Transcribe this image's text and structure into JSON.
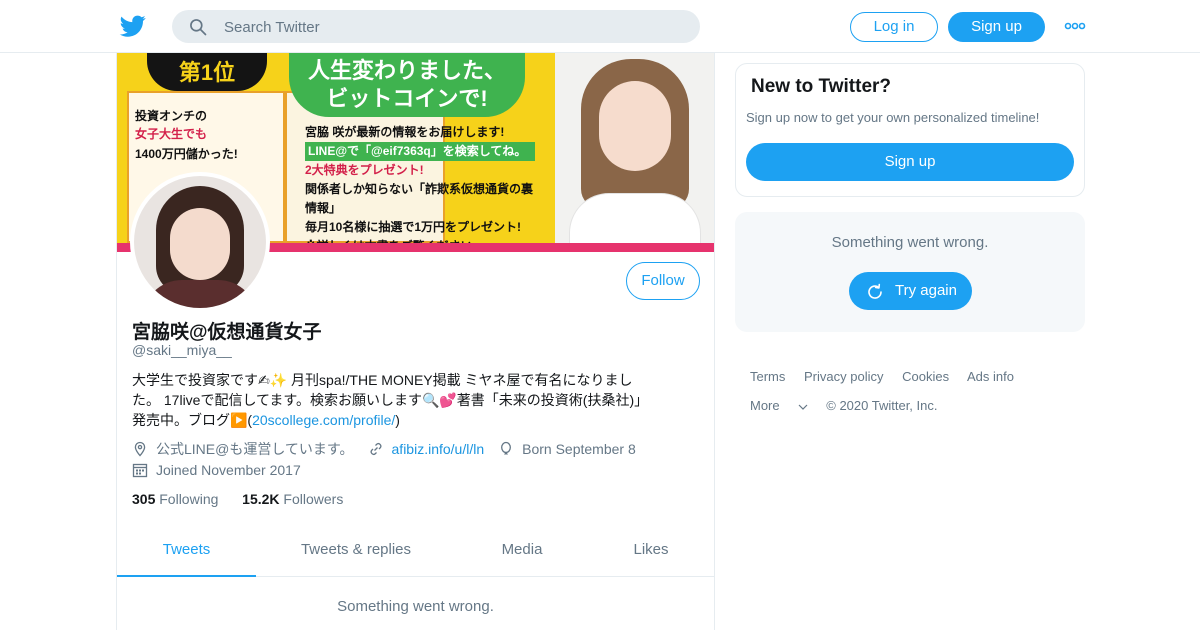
{
  "header": {
    "search_placeholder": "Search Twitter",
    "login_label": "Log in",
    "signup_label": "Sign up"
  },
  "banner": {
    "rank_text": "第1位",
    "book_line1": "投資オンチの",
    "book_line2": "女子大生でも",
    "book_line3": "1400万円儲かった!",
    "bubble_line1": "人生変わりました、",
    "bubble_line2": "ビットコインで!",
    "text_line1": "宮脇 咲が最新の情報をお届けします!",
    "text_line2": "LINE@で「@eif7363q」を検索してね。",
    "text_line3": "2大特典をプレゼント!",
    "text_line4": "関係者しか知らない「詐欺系仮想通貨の裏情報」",
    "text_line5": "毎月10名様に抽選で1万円をプレゼント!",
    "text_line6": "※詳しくは本書をご覧ください"
  },
  "profile": {
    "follow_label": "Follow",
    "name": "宮脇咲@仮想通貨女子",
    "handle": "@saki__miya__",
    "bio_line1": "大学生で投資家です✍✨ 月刊spa!/THE MONEY掲載 ミヤネ屋で有名になりまし",
    "bio_line2": "た。 17liveで配信してます。検索お願いします🔍💕著書「未来の投資術(扶桑社)」",
    "bio_line3_prefix": "発売中。ブログ▶️(",
    "bio_link": "20scollege.com/profile/",
    "bio_line3_suffix": ")",
    "location": "公式LINE@も運営しています。",
    "website": "afibiz.info/u/l/ln",
    "birthday": "Born September 8",
    "joined": "Joined November 2017",
    "following_count": "305",
    "following_label": "Following",
    "followers_count": "15.2K",
    "followers_label": "Followers"
  },
  "tabs": [
    {
      "label": "Tweets",
      "active": true
    },
    {
      "label": "Tweets & replies",
      "active": false
    },
    {
      "label": "Media",
      "active": false
    },
    {
      "label": "Likes",
      "active": false
    }
  ],
  "timeline": {
    "error_text": "Something went wrong."
  },
  "sidebar": {
    "new_title": "New to Twitter?",
    "new_subtitle": "Sign up now to get your own personalized timeline!",
    "new_signup_label": "Sign up",
    "error_text": "Something went wrong.",
    "try_again_label": "Try again"
  },
  "footer": {
    "terms": "Terms",
    "privacy": "Privacy policy",
    "cookies": "Cookies",
    "ads": "Ads info",
    "more": "More",
    "copyright": "© 2020 Twitter, Inc."
  },
  "colors": {
    "accent": "#1da1f2",
    "text_secondary": "#657786",
    "border": "#e6ecf0"
  }
}
